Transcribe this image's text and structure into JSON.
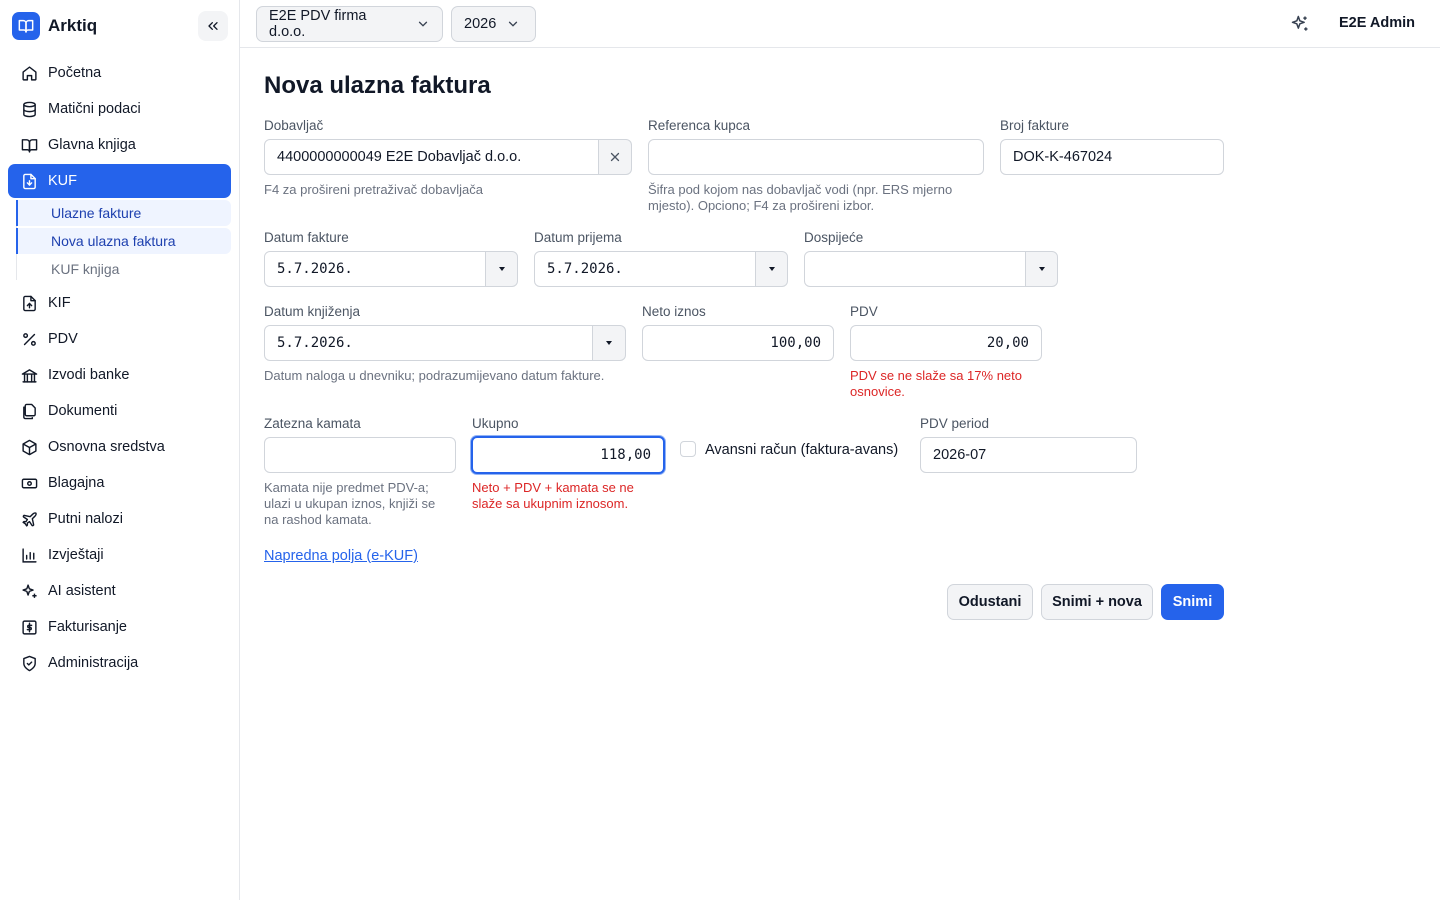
{
  "app": {
    "name": "Arktiq"
  },
  "sidebar": {
    "items": [
      {
        "label": "Početna",
        "icon": "home-icon"
      },
      {
        "label": "Matični podaci",
        "icon": "database-icon"
      },
      {
        "label": "Glavna knjiga",
        "icon": "book-open-icon"
      },
      {
        "label": "KUF",
        "icon": "file-download-icon",
        "active": true
      },
      {
        "label": "KIF",
        "icon": "file-upload-icon"
      },
      {
        "label": "PDV",
        "icon": "percent-icon"
      },
      {
        "label": "Izvodi banke",
        "icon": "bank-icon"
      },
      {
        "label": "Dokumenti",
        "icon": "documents-icon"
      },
      {
        "label": "Osnovna sredstva",
        "icon": "box-icon"
      },
      {
        "label": "Blagajna",
        "icon": "cash-icon"
      },
      {
        "label": "Putni nalozi",
        "icon": "plane-icon"
      },
      {
        "label": "Izvještaji",
        "icon": "bar-chart-icon"
      },
      {
        "label": "AI asistent",
        "icon": "sparkle-icon"
      },
      {
        "label": "Fakturisanje",
        "icon": "invoice-dollar-icon"
      },
      {
        "label": "Administracija",
        "icon": "shield-icon"
      }
    ],
    "kuf_sub": [
      {
        "label": "Ulazne fakture",
        "selected": true
      },
      {
        "label": "Nova ulazna faktura",
        "selected": true
      },
      {
        "label": "KUF knjiga",
        "selected": false
      }
    ]
  },
  "topbar": {
    "company": "E2E PDV firma d.o.o.",
    "year": "2026",
    "user": "E2E Admin"
  },
  "form": {
    "title": "Nova ulazna faktura",
    "supplier": {
      "label": "Dobavljač",
      "value": "4400000000049 E2E Dobavljač d.o.o.",
      "help": "F4 za prošireni pretraživač dobavljača"
    },
    "customer_ref": {
      "label": "Referenca kupca",
      "value": "",
      "help_line1": "Šifra pod kojom nas dobavljač vodi (npr. ERS mjerno",
      "help_line2": "mjesto). Opciono; F4 za prošireni izbor."
    },
    "invoice_no": {
      "label": "Broj fakture",
      "value": "DOK-K-467024"
    },
    "invoice_date": {
      "label": "Datum fakture",
      "value": "5.7.2026."
    },
    "receipt_date": {
      "label": "Datum prijema",
      "value": "5.7.2026."
    },
    "due_date": {
      "label": "Dospijeće",
      "value": ""
    },
    "posting_date": {
      "label": "Datum knjiženja",
      "value": "5.7.2026.",
      "help": "Datum naloga u dnevniku; podrazumijevano datum fakture."
    },
    "net": {
      "label": "Neto iznos",
      "value": "100,00"
    },
    "vat": {
      "label": "PDV",
      "value": "20,00",
      "error_line1": "PDV se ne slaže sa 17% neto",
      "error_line2": "osnovice."
    },
    "late_interest": {
      "label": "Zatezna kamata",
      "value": "",
      "help_line1": "Kamata nije predmet PDV-a;",
      "help_line2": "ulazi u ukupan iznos, knjiži se",
      "help_line3": "na rashod kamata."
    },
    "total": {
      "label": "Ukupno",
      "value": "118,00",
      "error_line1": "Neto + PDV + kamata se ne",
      "error_line2": "slaže sa ukupnim iznosom."
    },
    "advance": {
      "label": "Avansni račun (faktura-avans)",
      "checked": false
    },
    "vat_period": {
      "label": "PDV period",
      "value": "2026-07"
    },
    "advanced_link": "Napredna polja (e-KUF)",
    "buttons": {
      "cancel": "Odustani",
      "save_new": "Snimi + nova",
      "save": "Snimi"
    }
  },
  "colors": {
    "accent": "#2563eb",
    "error": "#dc2626",
    "muted": "#6b7280"
  }
}
